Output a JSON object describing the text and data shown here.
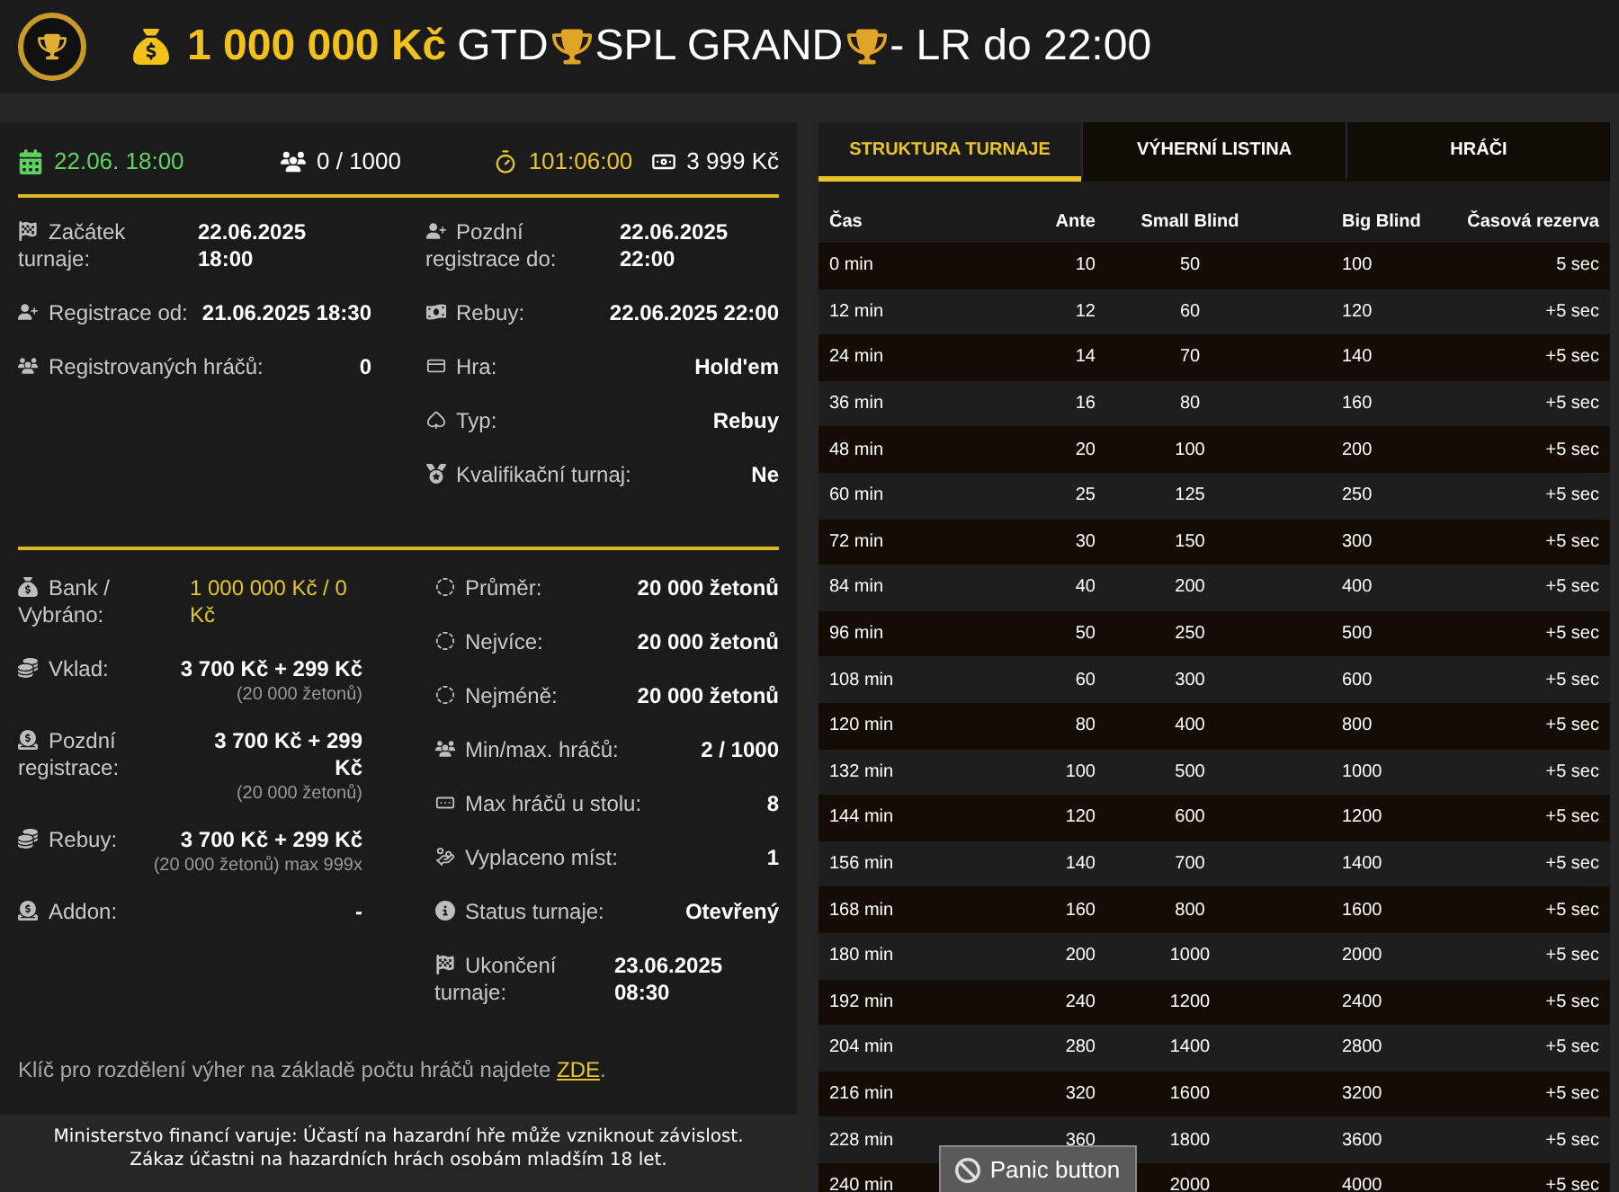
{
  "header": {
    "title_parts": [
      {
        "kind": "amount",
        "text": "1 000 000 Kč"
      },
      {
        "kind": "plain",
        "text": "GTD"
      },
      {
        "kind": "trophy"
      },
      {
        "kind": "plain",
        "text": "SPL GRAND"
      },
      {
        "kind": "trophy"
      },
      {
        "kind": "plain",
        "text": "- LR do 22:00"
      }
    ]
  },
  "stats": [
    {
      "kind": "date",
      "text": "22.06. 18:00"
    },
    {
      "kind": "players",
      "text": "0 / 1000"
    },
    {
      "kind": "timer",
      "text": "101:06:00"
    },
    {
      "kind": "price",
      "text": "3 999 Kč"
    }
  ],
  "details_left": [
    {
      "kind": "split",
      "label": "Začátek turnaje:",
      "value": "22.06.2025 18:00"
    },
    {
      "kind": "row",
      "label": "Registrace od:",
      "value": "21.06.2025 18:30"
    },
    {
      "kind": "row",
      "label": "Registrovaných hráčů:",
      "value": "0"
    }
  ],
  "details_right": [
    {
      "kind": "split",
      "label": "Pozdní registrace do:",
      "value": "22.06.2025 22:00"
    },
    {
      "kind": "row",
      "label": "Rebuy:",
      "value": "22.06.2025 22:00"
    },
    {
      "kind": "row",
      "label": "Hra:",
      "value": "Hold'em"
    },
    {
      "kind": "row",
      "label": "Typ:",
      "value": "Rebuy"
    },
    {
      "kind": "row",
      "label": "Kvalifikační turnaj:",
      "value": "Ne"
    }
  ],
  "money_left": [
    {
      "kind": "highlight",
      "label": "Bank / Vybráno:",
      "value": "1 000 000 Kč / 0 Kč"
    },
    {
      "kind": "row",
      "label": "Vklad:",
      "value": "3 700 Kč + 299 Kč",
      "note": "(20 000 žetonů)"
    },
    {
      "kind": "wrap",
      "label": "Pozdní registrace:",
      "value": "3 700 Kč + 299 Kč",
      "note": "(20 000 žetonů)"
    },
    {
      "kind": "row",
      "label": "Rebuy:",
      "value": "3 700 Kč + 299 Kč",
      "note": "(20 000 žetonů) max 999x"
    },
    {
      "kind": "row",
      "label": "Addon:",
      "value": "-"
    }
  ],
  "money_right": [
    {
      "kind": "row",
      "label": "Průměr:",
      "value": "20 000 žetonů"
    },
    {
      "kind": "row",
      "label": "Nejvíce:",
      "value": "20 000 žetonů"
    },
    {
      "kind": "row",
      "label": "Nejméně:",
      "value": "20 000 žetonů"
    },
    {
      "kind": "row",
      "label": "Min/max. hráčů:",
      "value": "2 / 1000"
    },
    {
      "kind": "row",
      "label": "Max hráčů u stolu:",
      "value": "8"
    },
    {
      "kind": "row",
      "label": "Vyplaceno míst:",
      "value": "1"
    },
    {
      "kind": "row",
      "label": "Status turnaje:",
      "value": "Otevřený"
    },
    {
      "kind": "split",
      "label": "Ukončení turnaje:",
      "value": "23.06.2025 08:30"
    }
  ],
  "prize_key": {
    "text": "Klíč pro rozdělení výher na základě počtu hráčů najdete",
    "link": "ZDE",
    "after": "."
  },
  "warning": [
    "Ministerstvo financí varuje: Účastí na hazardní hře může vzniknout závislost.",
    "Zákaz účastni na hazardních hrách osobám mladším 18 let."
  ],
  "tabs": [
    {
      "label": "STRUKTURA TURNAJE",
      "selected": true
    },
    {
      "label": "VÝHERNÍ LISTINA",
      "selected": false
    },
    {
      "label": "HRÁČI",
      "selected": false
    }
  ],
  "table": {
    "columns": [
      "Čas",
      "Ante",
      "Small Blind",
      "Big Blind",
      "Časová rezerva"
    ],
    "rows": [
      {
        "time": "0 min",
        "ante": "10",
        "small": "50",
        "big": "100",
        "reserve": "5 sec"
      },
      {
        "time": "12 min",
        "ante": "12",
        "small": "60",
        "big": "120",
        "reserve": "+5 sec"
      },
      {
        "time": "24 min",
        "ante": "14",
        "small": "70",
        "big": "140",
        "reserve": "+5 sec"
      },
      {
        "time": "36 min",
        "ante": "16",
        "small": "80",
        "big": "160",
        "reserve": "+5 sec"
      },
      {
        "time": "48 min",
        "ante": "20",
        "small": "100",
        "big": "200",
        "reserve": "+5 sec"
      },
      {
        "time": "60 min",
        "ante": "25",
        "small": "125",
        "big": "250",
        "reserve": "+5 sec"
      },
      {
        "time": "72 min",
        "ante": "30",
        "small": "150",
        "big": "300",
        "reserve": "+5 sec"
      },
      {
        "time": "84 min",
        "ante": "40",
        "small": "200",
        "big": "400",
        "reserve": "+5 sec"
      },
      {
        "time": "96 min",
        "ante": "50",
        "small": "250",
        "big": "500",
        "reserve": "+5 sec"
      },
      {
        "time": "108 min",
        "ante": "60",
        "small": "300",
        "big": "600",
        "reserve": "+5 sec"
      },
      {
        "time": "120 min",
        "ante": "80",
        "small": "400",
        "big": "800",
        "reserve": "+5 sec"
      },
      {
        "time": "132 min",
        "ante": "100",
        "small": "500",
        "big": "1000",
        "reserve": "+5 sec"
      },
      {
        "time": "144 min",
        "ante": "120",
        "small": "600",
        "big": "1200",
        "reserve": "+5 sec"
      },
      {
        "time": "156 min",
        "ante": "140",
        "small": "700",
        "big": "1400",
        "reserve": "+5 sec"
      },
      {
        "time": "168 min",
        "ante": "160",
        "small": "800",
        "big": "1600",
        "reserve": "+5 sec"
      },
      {
        "time": "180 min",
        "ante": "200",
        "small": "1000",
        "big": "2000",
        "reserve": "+5 sec"
      },
      {
        "time": "192 min",
        "ante": "240",
        "small": "1200",
        "big": "2400",
        "reserve": "+5 sec"
      },
      {
        "time": "204 min",
        "ante": "280",
        "small": "1400",
        "big": "2800",
        "reserve": "+5 sec"
      },
      {
        "time": "216 min",
        "ante": "320",
        "small": "1600",
        "big": "3200",
        "reserve": "+5 sec"
      },
      {
        "time": "228 min",
        "ante": "360",
        "small": "1800",
        "big": "3600",
        "reserve": "+5 sec"
      },
      {
        "time": "240 min",
        "small": "2000",
        "big": "4000",
        "reserve": "+5 sec"
      }
    ]
  },
  "panic_button": {
    "label": "Panic button"
  }
}
